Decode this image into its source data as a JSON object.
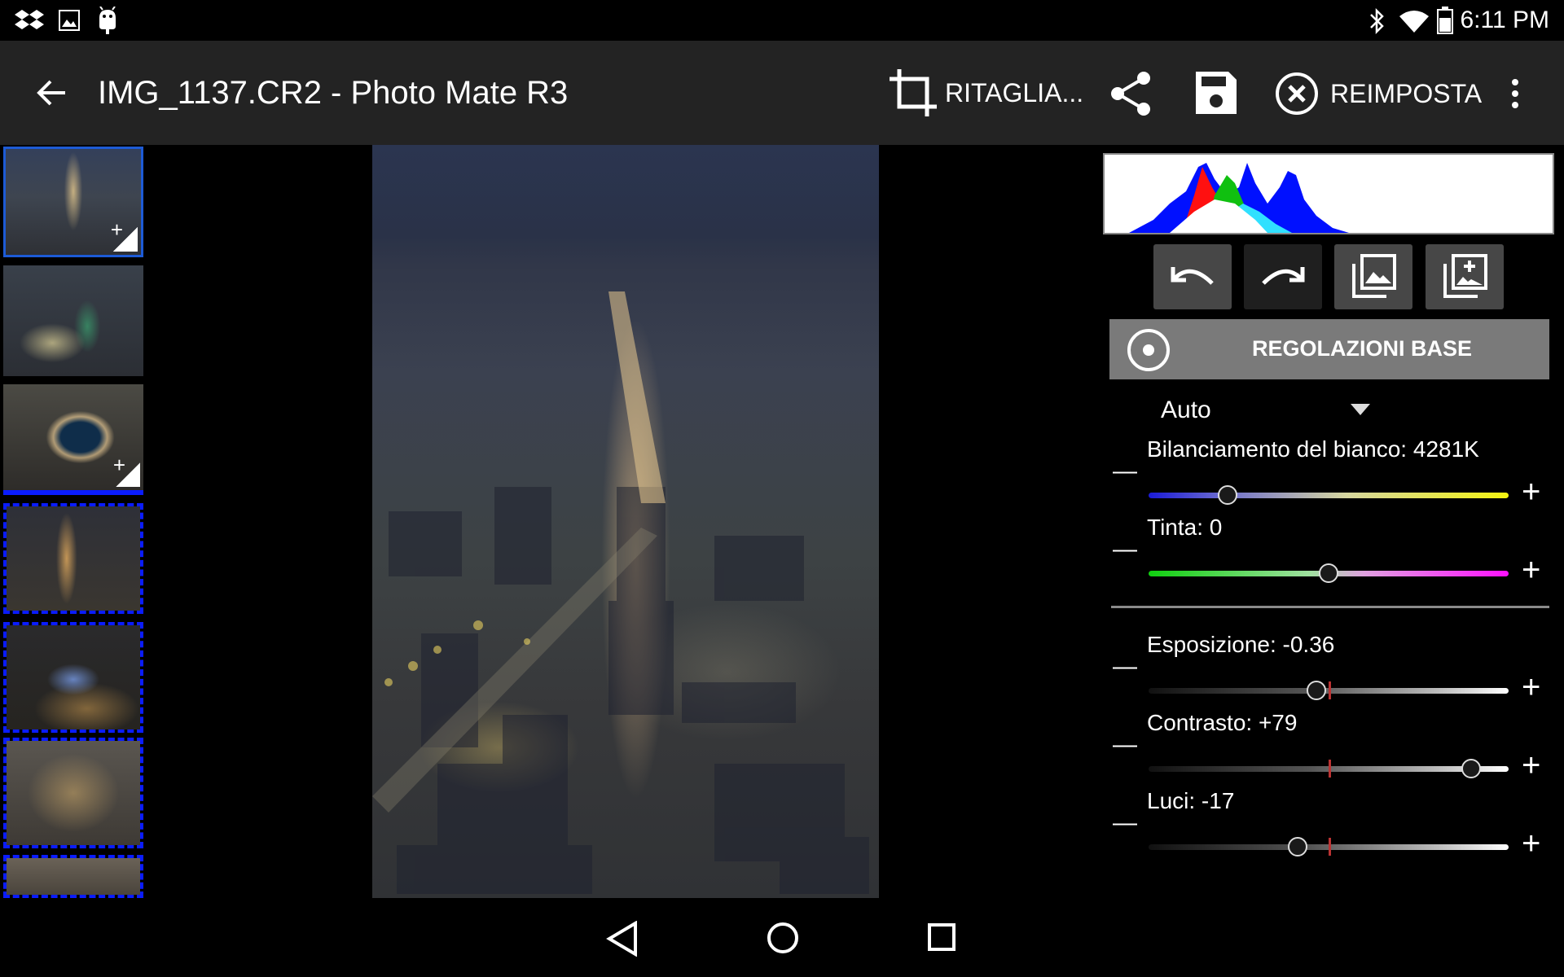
{
  "status_bar": {
    "time": "6:11 PM",
    "left_icons": [
      "dropbox-icon",
      "gallery-icon",
      "android-icon"
    ],
    "right_icons": [
      "bluetooth-icon",
      "wifi-icon",
      "battery-icon"
    ]
  },
  "app_bar": {
    "title": "IMG_1137.CR2 - Photo Mate R3",
    "crop_label": "RITAGLIA...",
    "reset_label": "REIMPOSTA"
  },
  "panel": {
    "section_title": "REGOLAZIONI BASE",
    "preset": "Auto",
    "sliders": [
      {
        "label": "Bilanciamento del bianco: 4281K",
        "value": 4281,
        "fraction": 0.22
      },
      {
        "label": "Tinta: 0",
        "value": 0,
        "fraction": 0.5
      },
      {
        "label": "Esposizione: -0.36",
        "value": -0.36,
        "fraction": 0.465
      },
      {
        "label": "Contrasto: +79",
        "value": 79,
        "fraction": 0.895
      },
      {
        "label": "Luci: -17",
        "value": -17,
        "fraction": 0.415
      }
    ]
  },
  "colors": {
    "app_bar": "#232323",
    "section_header": "#7a7a7a",
    "tool_button": "#474747",
    "selection": "#1d5bd6"
  }
}
